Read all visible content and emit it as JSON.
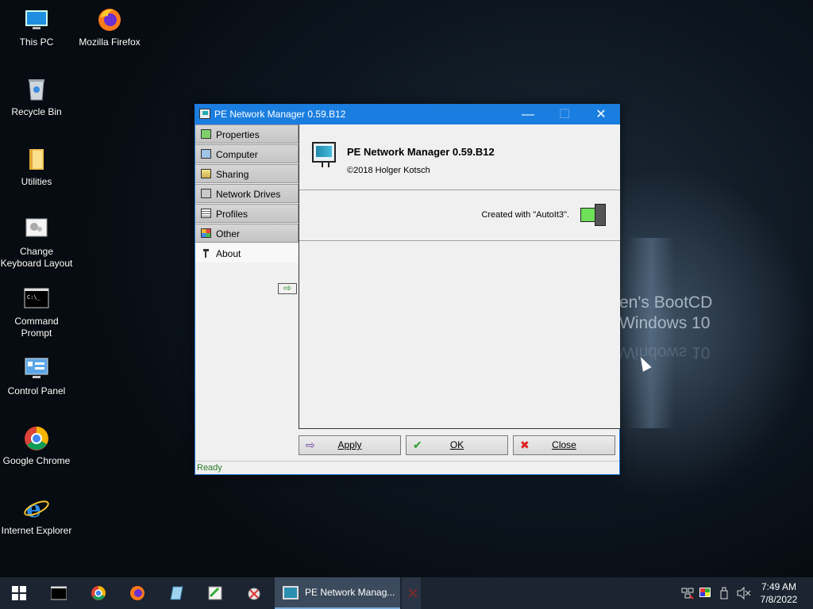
{
  "desktop": {
    "icons": [
      {
        "label": "This PC"
      },
      {
        "label": "Mozilla Firefox"
      },
      {
        "label": "Recycle Bin"
      },
      {
        "label": "Utilities"
      },
      {
        "label": "Change Keyboard Layout"
      },
      {
        "label": "Command Prompt"
      },
      {
        "label": "Control Panel"
      },
      {
        "label": "Google Chrome"
      },
      {
        "label": "Internet Explorer"
      }
    ],
    "wallpaper_line1": "en's BootCD",
    "wallpaper_line2": "Windows 10"
  },
  "window": {
    "title": "PE Network Manager 0.59.B12",
    "controls": {
      "minimize": "—",
      "maximize": "☐",
      "close": "✕"
    },
    "sidebar": {
      "items": [
        {
          "label": "Properties",
          "icon": "network-card-icon"
        },
        {
          "label": "Computer",
          "icon": "computer-icon"
        },
        {
          "label": "Sharing",
          "icon": "sharing-icon"
        },
        {
          "label": "Network Drives",
          "icon": "network-drive-icon"
        },
        {
          "label": "Profiles",
          "icon": "profiles-icon"
        },
        {
          "label": "Other",
          "icon": "other-icon"
        },
        {
          "label": "About",
          "icon": "about-icon",
          "active": true
        }
      ],
      "arrow": "⇨"
    },
    "about": {
      "title": "PE Network Manager 0.59.B12",
      "copyright": "©2018 Holger Kotsch",
      "created_with": "Created with \"AutoIt3\"."
    },
    "buttons": {
      "apply": "Apply",
      "ok": "OK",
      "close": "Close"
    },
    "status": "Ready"
  },
  "taskbar": {
    "active_window": "PE Network Manag...",
    "time": "7:49 AM",
    "date": "7/8/2022"
  },
  "colors": {
    "titlebar": "#1a7ee0",
    "taskbar": "#1b2430",
    "status_text": "#2a7a2a"
  }
}
